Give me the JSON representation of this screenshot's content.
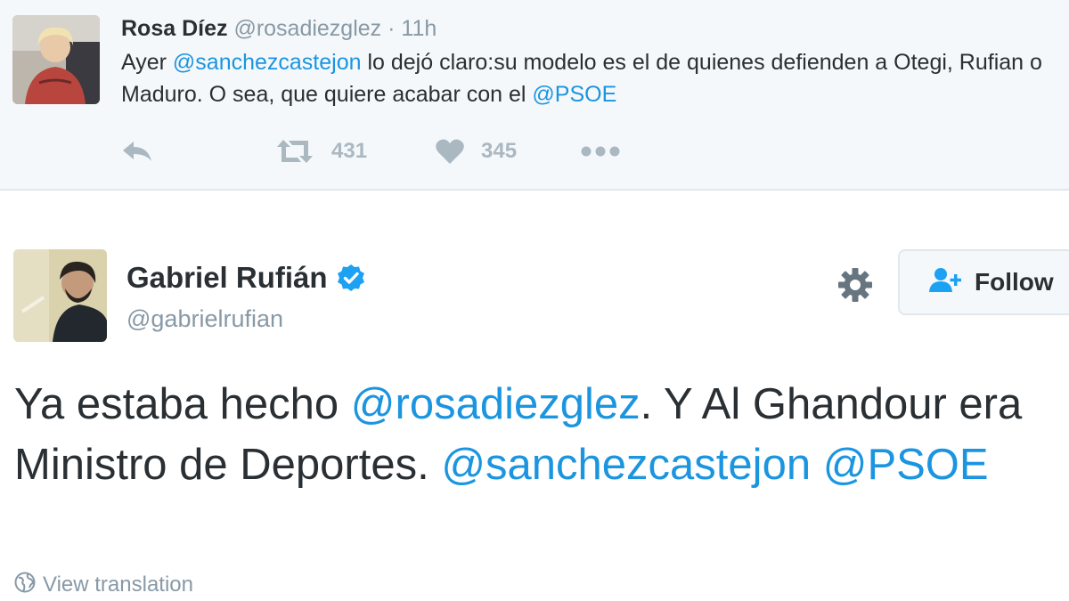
{
  "reply_tweet": {
    "author_name": "Rosa Díez",
    "handle": "@rosadiezglez",
    "separator": "·",
    "time": "11h",
    "text_parts": [
      {
        "text": "Ayer ",
        "link": false
      },
      {
        "text": "@sanchezcastejon",
        "link": true
      },
      {
        "text": " lo dejó claro:su modelo es el de quienes defienden a Otegi, Rufian o Maduro. O sea, que quiere acabar con el ",
        "link": false
      },
      {
        "text": "@PSOE",
        "link": true
      }
    ],
    "retweet_count": "431",
    "like_count": "345",
    "icons": [
      "reply-icon",
      "retweet-icon",
      "heart-icon",
      "more-icon"
    ]
  },
  "main_tweet": {
    "author_name": "Gabriel Rufián",
    "handle": "@gabrielrufian",
    "follow_label": "Follow",
    "text_parts": [
      {
        "text": "Ya estaba hecho ",
        "link": false
      },
      {
        "text": "@rosadiezglez",
        "link": true
      },
      {
        "text": ". Y Al Ghandour era Ministro de Deportes. ",
        "link": false
      },
      {
        "text": "@sanchezcastejon",
        "link": true
      },
      {
        "text": " ",
        "link": false
      },
      {
        "text": "@PSOE",
        "link": true
      }
    ],
    "view_translation": "View translation",
    "icons": [
      "verified-icon",
      "gear-icon",
      "add-user-icon",
      "globe-icon"
    ]
  },
  "colors": {
    "link": "#1b95e0",
    "text": "#292f33",
    "muted": "#8899a6",
    "action_gray": "#aab8c2",
    "verified_blue": "#1da1f2",
    "reply_background": "#f5f8fa"
  }
}
